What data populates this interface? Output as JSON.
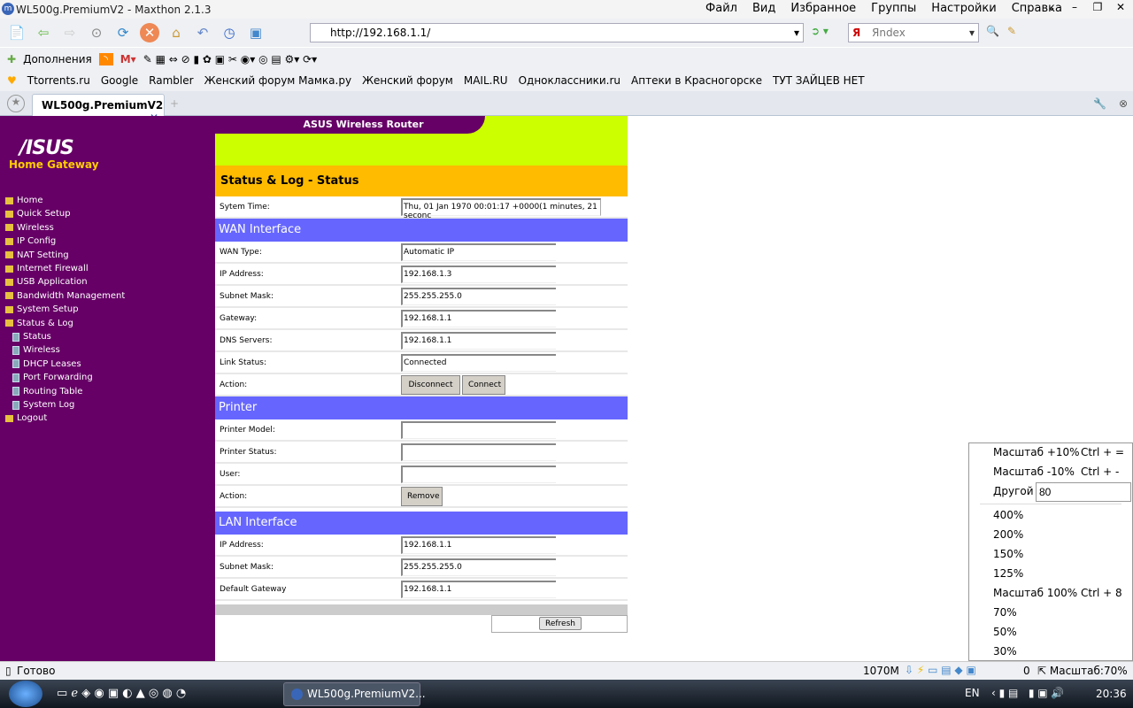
{
  "window": {
    "title": "WL500g.PremiumV2 - Maxthon 2.1.3",
    "menu": [
      "Файл",
      "Вид",
      "Избранное",
      "Группы",
      "Настройки",
      "Справка"
    ]
  },
  "toolbar": {
    "url": "http://192.168.1.1/",
    "search_placeholder": "Яndex"
  },
  "addons": {
    "label": "Дополнения"
  },
  "favorites": [
    "Ttorrents.ru",
    "Google",
    "Rambler",
    "Женский форум Мамка.ру",
    "Женский форум",
    "MAIL.RU",
    "Одноклассники.ru",
    "Аптеки в Красногорске",
    "ТУТ ЗАЙЦЕВ НЕТ"
  ],
  "tab": {
    "label": "WL500g.PremiumV2"
  },
  "router": {
    "header": "ASUS Wireless Router",
    "logo": "ASUS",
    "subtitle": "Home Gateway",
    "nav": [
      "Home",
      "Quick Setup",
      "Wireless",
      "IP Config",
      "NAT Setting",
      "Internet Firewall",
      "USB Application",
      "Bandwidth Management",
      "System Setup",
      "Status & Log"
    ],
    "subnav": [
      "Status",
      "Wireless",
      "DHCP Leases",
      "Port Forwarding",
      "Routing Table",
      "System Log"
    ],
    "logout": "Logout",
    "page_title": "Status & Log - Status",
    "system_time_label": "Sytem Time:",
    "system_time": "Thu, 01 Jan 1970 00:01:17 +0000(1 minutes, 21 seconc",
    "wan": {
      "title": "WAN Interface",
      "rows": [
        [
          "WAN Type:",
          "Automatic IP"
        ],
        [
          "IP Address:",
          "192.168.1.3"
        ],
        [
          "Subnet Mask:",
          "255.255.255.0"
        ],
        [
          "Gateway:",
          "192.168.1.1"
        ],
        [
          "DNS Servers:",
          "192.168.1.1"
        ],
        [
          "Link Status:",
          "Connected"
        ]
      ],
      "action_label": "Action:",
      "disconnect": "Disconnect",
      "connect": "Connect"
    },
    "printer": {
      "title": "Printer",
      "rows": [
        [
          "Printer Model:",
          ""
        ],
        [
          "Printer Status:",
          ""
        ],
        [
          "User:",
          ""
        ]
      ],
      "action_label": "Action:",
      "remove": "Remove"
    },
    "lan": {
      "title": "LAN Interface",
      "rows": [
        [
          "IP Address:",
          "192.168.1.1"
        ],
        [
          "Subnet Mask:",
          "255.255.255.0"
        ],
        [
          "Default Gateway",
          "192.168.1.1"
        ]
      ]
    },
    "refresh": "Refresh"
  },
  "zoom_menu": {
    "plus": "Масштаб +10%",
    "plus_key": "Ctrl + =",
    "minus": "Масштаб -10%",
    "minus_key": "Ctrl + -",
    "other": "Другой",
    "other_value": "80",
    "levels": [
      "400%",
      "200%",
      "150%",
      "125%"
    ],
    "reset": "Масштаб 100%",
    "reset_key": "Ctrl + 8",
    "levels2": [
      "70%",
      "50%",
      "30%"
    ]
  },
  "status": {
    "text": "Готово",
    "memory": "1070M",
    "popups": "0",
    "zoom": "Масштаб:70%"
  },
  "taskbar": {
    "task": "WL500g.PremiumV2...",
    "lang": "EN",
    "time": "20:36"
  }
}
